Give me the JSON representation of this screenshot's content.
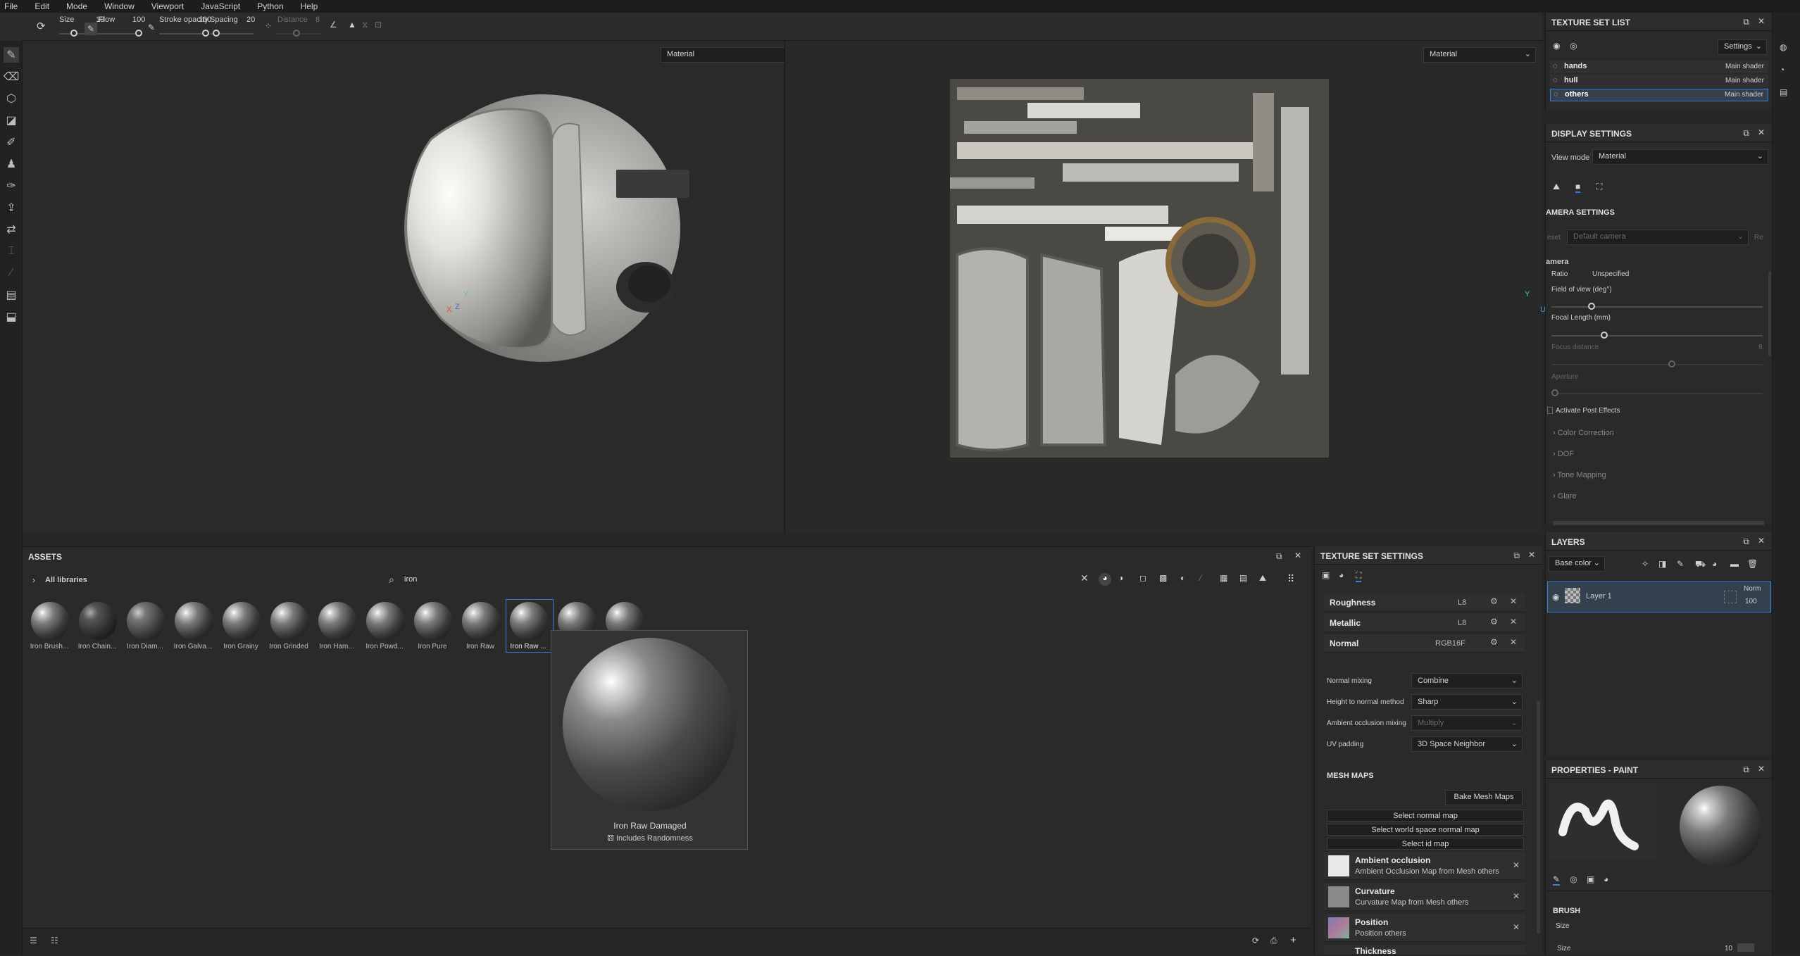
{
  "menu": [
    "File",
    "Edit",
    "Mode",
    "Window",
    "Viewport",
    "JavaScript",
    "Python",
    "Help"
  ],
  "toolbar": {
    "size_label": "Size",
    "size_value": "10",
    "flow_label": "Flow",
    "flow_value": "100",
    "stroke_opacity_label": "Stroke opacity",
    "stroke_opacity_value": "100",
    "spacing_label": "Spacing",
    "spacing_value": "20",
    "distance_label": "Distance",
    "distance_value": "8"
  },
  "viewport3d": {
    "mode": "Material",
    "axis_x": "X",
    "axis_y": "Y",
    "axis_z": "Z"
  },
  "viewport2d": {
    "mode": "Material",
    "axis_y": "Y",
    "axis_u": "U"
  },
  "texture_set_list": {
    "title": "TEXTURE SET LIST",
    "settings": "Settings",
    "items": [
      {
        "name": "hands",
        "shader": "Main shader"
      },
      {
        "name": "hull",
        "shader": "Main shader"
      },
      {
        "name": "others",
        "shader": "Main shader"
      }
    ]
  },
  "display_settings": {
    "title": "DISPLAY SETTINGS",
    "view_mode_label": "View mode",
    "view_mode_value": "Material",
    "camera_settings_title": "AMERA SETTINGS",
    "preset_label": "eset",
    "preset_value": "Default camera",
    "preset_btn": "Re",
    "camera_label": "amera",
    "ratio_label": "Ratio",
    "ratio_value": "Unspecified",
    "fov_label": "Field of view (deg°)",
    "focal_label": "Focal Length (mm)",
    "focus_label": "Focus distance",
    "focus_value": "8.",
    "aperture_label": "Aperture",
    "post_effects": "Activate Post Effects",
    "sections": [
      "Color Correction",
      "DOF",
      "Tone Mapping",
      "Glare"
    ]
  },
  "assets": {
    "title": "ASSETS",
    "library": "All libraries",
    "search_value": "iron",
    "items": [
      "Iron Brush...",
      "Iron Chain...",
      "Iron Diam...",
      "Iron Galva...",
      "Iron Grainy",
      "Iron Grinded",
      "Iron Ham...",
      "Iron Powd...",
      "Iron Pure",
      "Iron Raw",
      "Iron Raw ...",
      "",
      ""
    ],
    "preview_name": "Iron Raw Damaged",
    "preview_note": "Includes Randomness"
  },
  "texture_set_settings": {
    "title": "TEXTURE SET SETTINGS",
    "channels": [
      {
        "name": "Roughness",
        "format": "L8"
      },
      {
        "name": "Metallic",
        "format": "L8"
      },
      {
        "name": "Normal",
        "format": "RGB16F"
      }
    ],
    "normal_mixing_label": "Normal mixing",
    "normal_mixing_value": "Combine",
    "height_normal_label": "Height to normal method",
    "height_normal_value": "Sharp",
    "ao_mixing_label": "Ambient occlusion mixing",
    "ao_mixing_value": "Multiply",
    "uv_padding_label": "UV padding",
    "uv_padding_value": "3D Space Neighbor",
    "mesh_maps_title": "MESH MAPS",
    "bake_button": "Bake Mesh Maps",
    "select_normal": "Select normal map",
    "select_world_normal": "Select world space normal map",
    "select_id": "Select id map",
    "maps": [
      {
        "name": "Ambient occlusion",
        "desc": "Ambient Occlusion Map from Mesh others"
      },
      {
        "name": "Curvature",
        "desc": "Curvature Map from Mesh others"
      },
      {
        "name": "Position",
        "desc": "Position others"
      },
      {
        "name": "Thickness",
        "desc": ""
      }
    ]
  },
  "layers": {
    "title": "LAYERS",
    "channel": "Base color",
    "layer_name": "Layer 1",
    "blend": "Norm",
    "opacity": "100"
  },
  "properties": {
    "title": "PROPERTIES - PAINT",
    "brush_title": "BRUSH",
    "size_label": "Size",
    "size_row_label": "Size",
    "size_value": "10"
  },
  "colors": {
    "accent": "#3d7fd6",
    "panel": "#2a2a2a",
    "bg": "#262626"
  }
}
